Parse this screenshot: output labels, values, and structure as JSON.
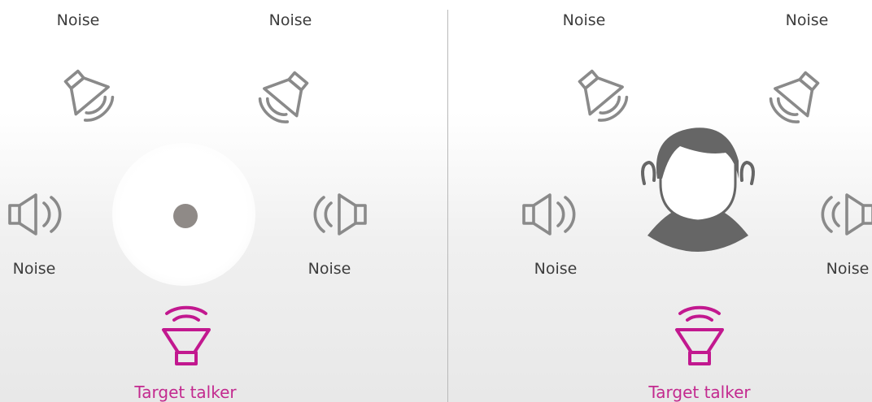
{
  "colors": {
    "icon_gray": "#8a8a8a",
    "target_magenta": "#c2188f",
    "target_label": "#c32a8f",
    "head_gray": "#666666",
    "divider": "#b9b9b9"
  },
  "left_panel": {
    "top_left_noise": "Noise",
    "top_right_noise": "Noise",
    "mid_left_noise": "Noise",
    "mid_right_noise": "Noise",
    "target": "Target talker",
    "center_icon": "point-source-dot"
  },
  "right_panel": {
    "top_left_noise": "Noise",
    "top_right_noise": "Noise",
    "mid_left_noise": "Noise",
    "mid_right_noise": "Noise",
    "target": "Target talker",
    "center_icon": "listener-head-with-hearing-aids"
  }
}
